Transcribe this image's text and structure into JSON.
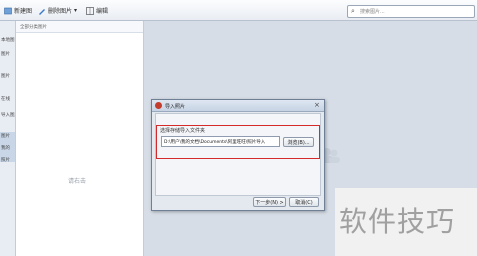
{
  "toolbar": {
    "btn1_label": "新建图",
    "btn2_label": "删除图片",
    "btn3_label": "编辑"
  },
  "search": {
    "placeholder": "搜索图片..."
  },
  "nav": {
    "items": [
      "本地图",
      "图片",
      "图片",
      "在线",
      "导入图片..",
      "图片",
      "我的",
      "照片"
    ]
  },
  "list": {
    "header_label": "全部分类图片",
    "empty_text": "请右击"
  },
  "dialog": {
    "title": "导入照片",
    "field_label": "选择存储导入文件夹",
    "path_value": "D:\\用户\\我的文档\\Documents\\阿里旺旺\\照片导入",
    "browse_label": "浏览(B)...",
    "next_label": "下一步(N) >",
    "cancel_label": "取消(C)"
  },
  "watermark": {
    "text": "软件技巧"
  },
  "colors": {
    "highlight_border": "#d42a2a",
    "title_icon": "#c43c2c"
  },
  "icons": {
    "toolbar1": "photo-icon",
    "toolbar2": "pencil-icon",
    "toolbar3": "grid-icon",
    "search": "magnifier-icon",
    "close": "close-icon"
  }
}
